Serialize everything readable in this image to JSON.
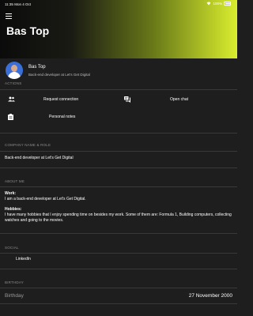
{
  "status_bar": {
    "time": "11:35",
    "date": "Mon 4 Oct",
    "battery": "100%"
  },
  "header": {
    "title": "Bas Top"
  },
  "profile": {
    "name": "Bas Top",
    "subtitle": "Back-end developer at Let's Get Digital"
  },
  "actions": {
    "section_label": "ACTIONS",
    "request_connection": "Request connection",
    "open_chat": "Open chat",
    "personal_notes": "Personal notes"
  },
  "company": {
    "section_label": "COMPANY NAME & ROLE",
    "value": "Back-end developer at Let's Get Digital"
  },
  "about": {
    "section_label": "ABOUT ME",
    "work_heading": "Work:",
    "work_text": "I am a back-end developer at Let's Get Digital.",
    "hobbies_heading": "Hobbies:",
    "hobbies_text": "I have many hobbies that I enjoy spending time on besides my work. Some of them are: Formula 1, Building computers, collecting watches and going to the movies."
  },
  "social": {
    "section_label": "SOCIAL",
    "linkedin": "LinkedIn"
  },
  "birthday": {
    "section_label": "BIRTHDAY",
    "label": "Birthday",
    "value": "27 November 2000"
  }
}
